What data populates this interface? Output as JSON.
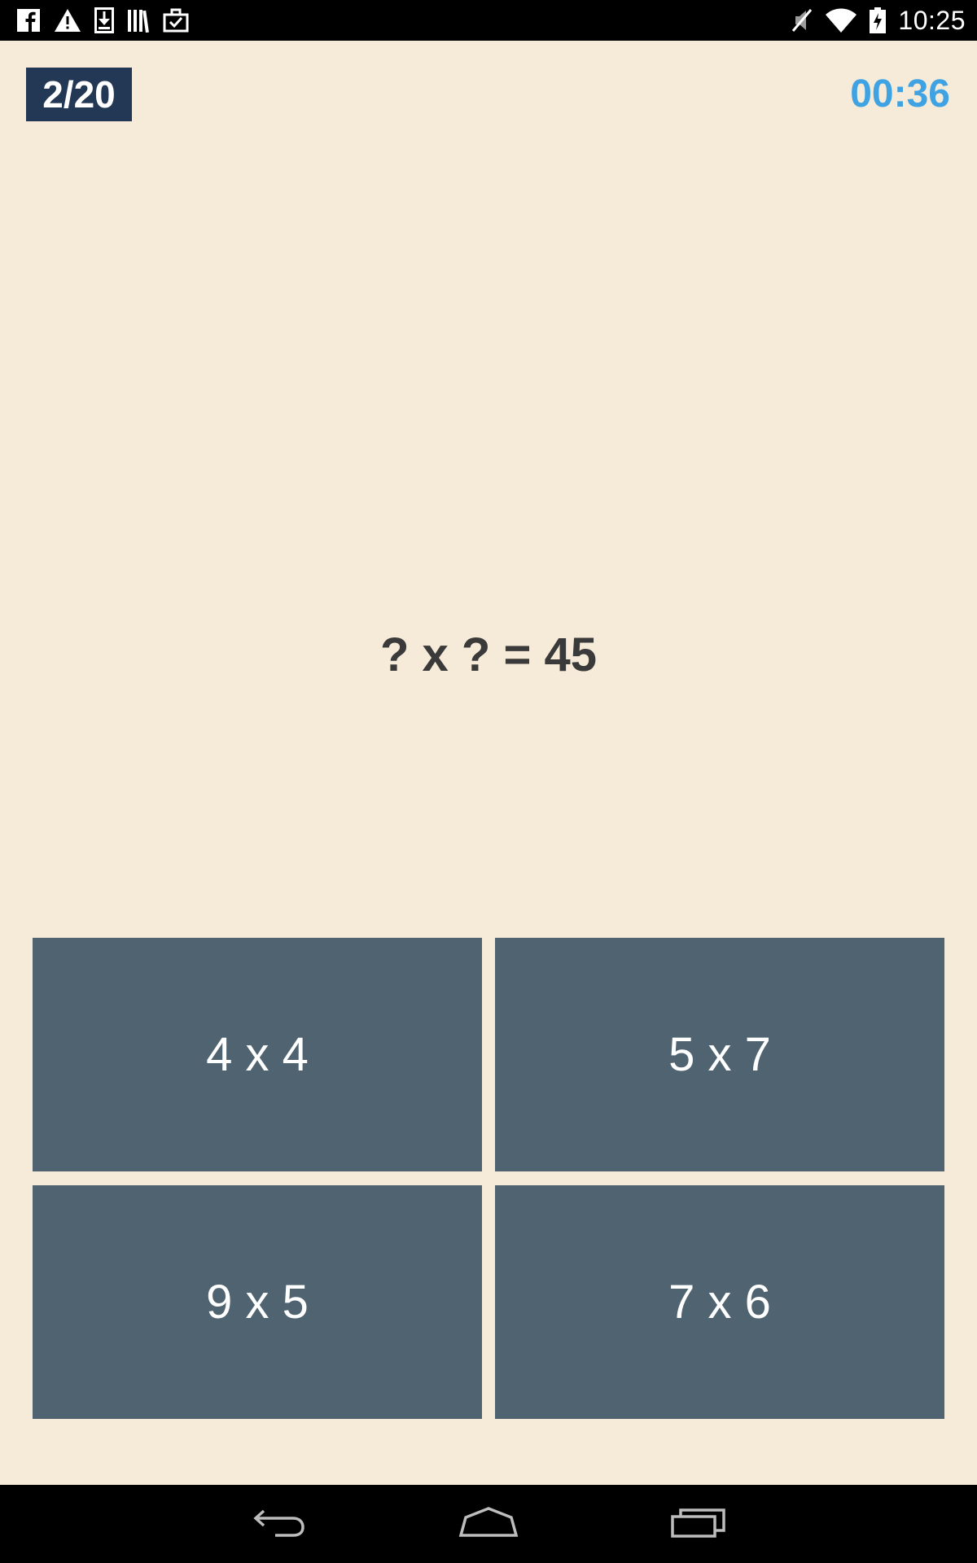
{
  "status_bar": {
    "time": "10:25",
    "left_icons": [
      "facebook-icon",
      "warning-icon",
      "download-icon",
      "library-icon",
      "briefcase-check-icon"
    ],
    "right_icons": [
      "mute-icon",
      "wifi-icon",
      "battery-charging-icon"
    ]
  },
  "quiz": {
    "progress": "2/20",
    "timer": "00:36",
    "question": "? x ? = 45",
    "answers": [
      "4 x 4",
      "5 x 7",
      "9 x 5",
      "7 x 6"
    ]
  },
  "colors": {
    "background": "#f6ebd8",
    "badge": "#233855",
    "timer": "#3fa2e2",
    "answer_button": "#4f6470",
    "question_text": "#3a3a3a"
  },
  "nav_bar": {
    "icons": [
      "back-icon",
      "home-icon",
      "recent-apps-icon"
    ]
  }
}
